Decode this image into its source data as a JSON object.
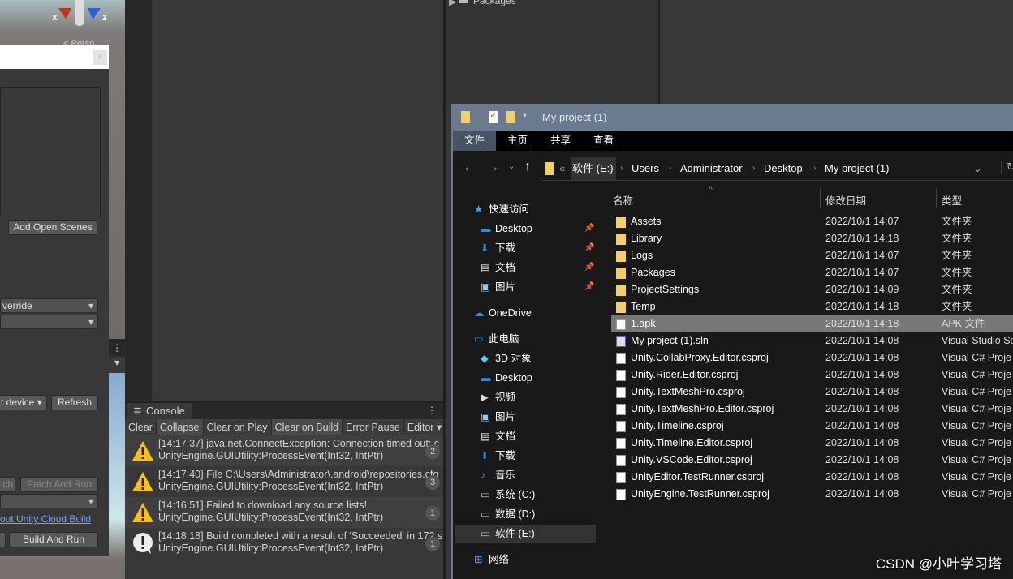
{
  "scene": {
    "axis_x": "x",
    "axis_z": "z",
    "persp": "< Persp"
  },
  "build_settings": {
    "close": "x",
    "add_open_scenes": "Add Open Scenes",
    "texture_override": "verride",
    "device_select": "t device",
    "refresh": "Refresh",
    "patch": "ch",
    "patch_and_run": "Patch And Run",
    "cloud_link": "out Unity Cloud Build",
    "build_and_run": "Build And Run"
  },
  "project": {
    "packages": "Packages"
  },
  "console": {
    "title": "Console",
    "toolbar": [
      "Clear",
      "Collapse",
      "Clear on Play",
      "Clear on Build",
      "Error Pause",
      "Editor ▾"
    ],
    "logs": [
      {
        "type": "warning",
        "line1": "[14:17:37]  java.net.ConnectException: Connection timed out: c",
        "line2": "UnityEngine.GUIUtility:ProcessEvent(Int32, IntPtr)",
        "count": "2"
      },
      {
        "type": "warning",
        "line1": "[14:17:40]  File C:\\Users\\Administrator\\.android\\repositories.cfg",
        "line2": "UnityEngine.GUIUtility:ProcessEvent(Int32, IntPtr)",
        "count": "3"
      },
      {
        "type": "warning",
        "line1": "[14:16:51]  Failed to download any source lists!",
        "line2": "UnityEngine.GUIUtility:ProcessEvent(Int32, IntPtr)",
        "count": "1"
      },
      {
        "type": "info",
        "line1": "[14:18:18] Build completed with a result of 'Succeeded' in 172 s",
        "line2": "UnityEngine.GUIUtility:ProcessEvent(Int32, IntPtr)",
        "count": "1"
      }
    ]
  },
  "explorer": {
    "title": "My project (1)",
    "ribbon": [
      "文件",
      "主页",
      "共享",
      "查看"
    ],
    "breadcrumb": [
      "软件 (E:)",
      "Users",
      "Administrator",
      "Desktop",
      "My project (1)"
    ],
    "columns": [
      "名称",
      "修改日期",
      "类型"
    ],
    "nav": [
      {
        "label": "快速访问",
        "icon": "star",
        "lvl": 0
      },
      {
        "label": "Desktop",
        "icon": "desktop",
        "lvl": 1,
        "pin": true
      },
      {
        "label": "下载",
        "icon": "download",
        "lvl": 1,
        "pin": true
      },
      {
        "label": "文档",
        "icon": "doc",
        "lvl": 1,
        "pin": true
      },
      {
        "label": "图片",
        "icon": "picture",
        "lvl": 1,
        "pin": true
      },
      {
        "label": "OneDrive",
        "icon": "cloud",
        "lvl": 0
      },
      {
        "label": "此电脑",
        "icon": "pc",
        "lvl": 0
      },
      {
        "label": "3D 对象",
        "icon": "cube",
        "lvl": 1
      },
      {
        "label": "Desktop",
        "icon": "desktop",
        "lvl": 1
      },
      {
        "label": "视频",
        "icon": "video",
        "lvl": 1
      },
      {
        "label": "图片",
        "icon": "picture",
        "lvl": 1
      },
      {
        "label": "文档",
        "icon": "doc",
        "lvl": 1
      },
      {
        "label": "下载",
        "icon": "download",
        "lvl": 1
      },
      {
        "label": "音乐",
        "icon": "music",
        "lvl": 1
      },
      {
        "label": "系统 (C:)",
        "icon": "drive",
        "lvl": 1
      },
      {
        "label": "数据 (D:)",
        "icon": "drive",
        "lvl": 1
      },
      {
        "label": "软件 (E:)",
        "icon": "drive",
        "lvl": 1,
        "selected": true
      },
      {
        "label": "网络",
        "icon": "network",
        "lvl": 0
      }
    ],
    "files": [
      {
        "name": "Assets",
        "date": "2022/10/1 14:07",
        "type": "文件夹",
        "icon": "folder"
      },
      {
        "name": "Library",
        "date": "2022/10/1 14:18",
        "type": "文件夹",
        "icon": "folder"
      },
      {
        "name": "Logs",
        "date": "2022/10/1 14:07",
        "type": "文件夹",
        "icon": "folder"
      },
      {
        "name": "Packages",
        "date": "2022/10/1 14:07",
        "type": "文件夹",
        "icon": "folder"
      },
      {
        "name": "ProjectSettings",
        "date": "2022/10/1 14:09",
        "type": "文件夹",
        "icon": "folder"
      },
      {
        "name": "Temp",
        "date": "2022/10/1 14:18",
        "type": "文件夹",
        "icon": "folder"
      },
      {
        "name": "1.apk",
        "date": "2022/10/1 14:18",
        "type": "APK 文件",
        "icon": "file",
        "selected": true
      },
      {
        "name": "My project (1).sln",
        "date": "2022/10/1 14:08",
        "type": "Visual Studio So",
        "icon": "sln"
      },
      {
        "name": "Unity.CollabProxy.Editor.csproj",
        "date": "2022/10/1 14:08",
        "type": "Visual C# Proje",
        "icon": "file"
      },
      {
        "name": "Unity.Rider.Editor.csproj",
        "date": "2022/10/1 14:08",
        "type": "Visual C# Proje",
        "icon": "file"
      },
      {
        "name": "Unity.TextMeshPro.csproj",
        "date": "2022/10/1 14:08",
        "type": "Visual C# Proje",
        "icon": "file"
      },
      {
        "name": "Unity.TextMeshPro.Editor.csproj",
        "date": "2022/10/1 14:08",
        "type": "Visual C# Proje",
        "icon": "file"
      },
      {
        "name": "Unity.Timeline.csproj",
        "date": "2022/10/1 14:08",
        "type": "Visual C# Proje",
        "icon": "file"
      },
      {
        "name": "Unity.Timeline.Editor.csproj",
        "date": "2022/10/1 14:08",
        "type": "Visual C# Proje",
        "icon": "file"
      },
      {
        "name": "Unity.VSCode.Editor.csproj",
        "date": "2022/10/1 14:08",
        "type": "Visual C# Proje",
        "icon": "file"
      },
      {
        "name": "UnityEditor.TestRunner.csproj",
        "date": "2022/10/1 14:08",
        "type": "Visual C# Proje",
        "icon": "file"
      },
      {
        "name": "UnityEngine.TestRunner.csproj",
        "date": "2022/10/1 14:08",
        "type": "Visual C# Proje",
        "icon": "file"
      }
    ]
  },
  "watermark": "CSDN @小叶学习塔"
}
